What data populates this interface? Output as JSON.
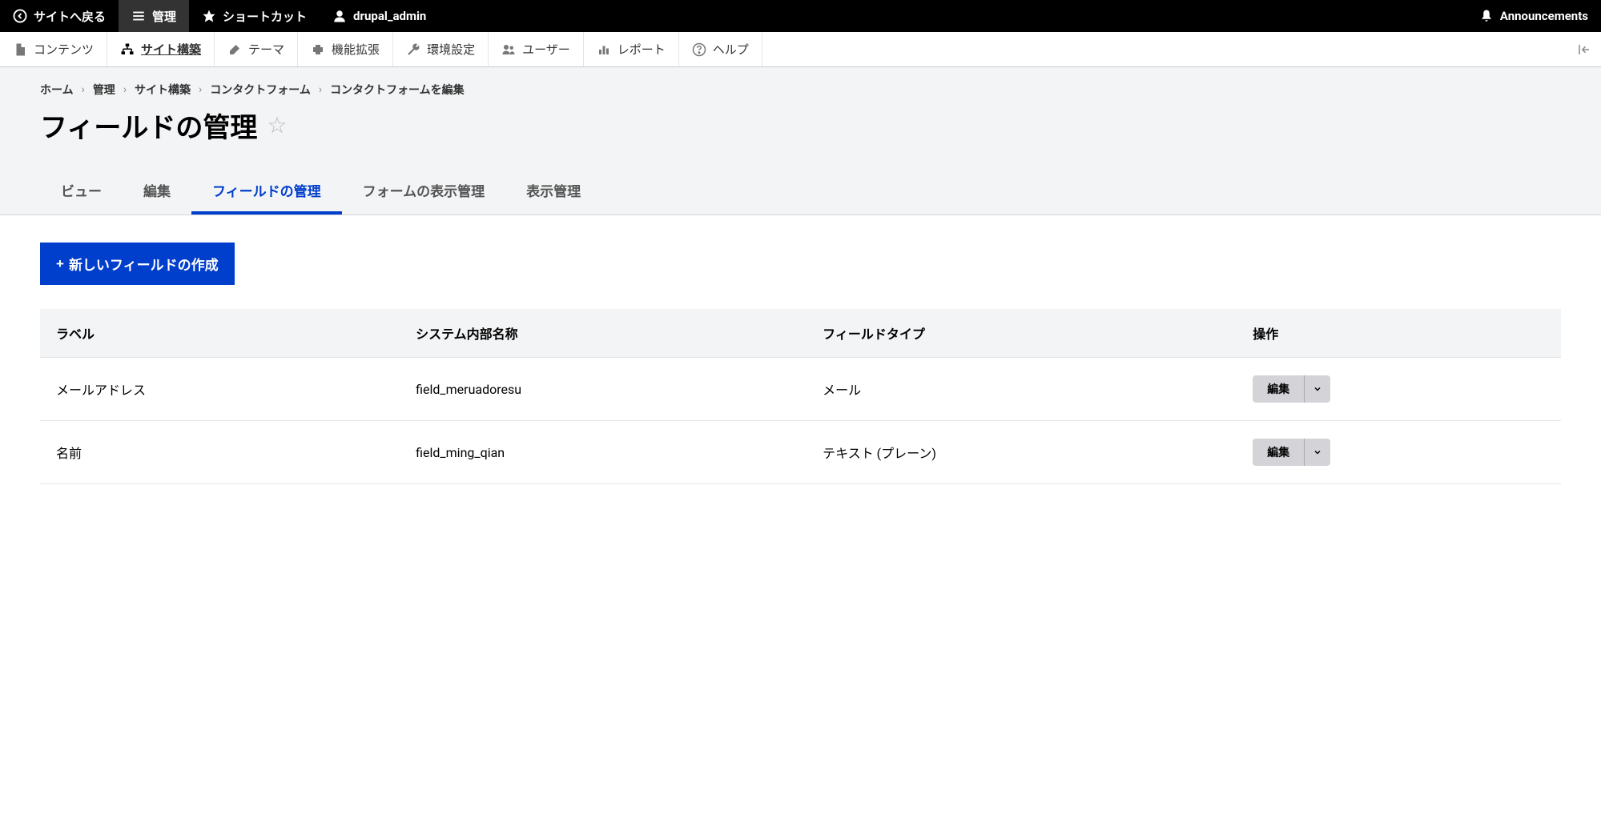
{
  "topbar": {
    "back_to_site": "サイトへ戻る",
    "manage": "管理",
    "shortcuts": "ショートカット",
    "user": "drupal_admin",
    "announcements": "Announcements"
  },
  "adminbar": {
    "content": "コンテンツ",
    "structure": "サイト構築",
    "appearance": "テーマ",
    "extend": "機能拡張",
    "configuration": "環境設定",
    "people": "ユーザー",
    "reports": "レポート",
    "help": "ヘルプ"
  },
  "breadcrumb": {
    "items": [
      "ホーム",
      "管理",
      "サイト構築",
      "コンタクトフォーム",
      "コンタクトフォームを編集"
    ]
  },
  "page_title": "フィールドの管理",
  "tabs": {
    "items": [
      {
        "label": "ビュー",
        "active": false
      },
      {
        "label": "編集",
        "active": false
      },
      {
        "label": "フィールドの管理",
        "active": true
      },
      {
        "label": "フォームの表示管理",
        "active": false
      },
      {
        "label": "表示管理",
        "active": false
      }
    ]
  },
  "button_create": "新しいフィールドの作成",
  "table": {
    "headers": {
      "label": "ラベル",
      "machine_name": "システム内部名称",
      "field_type": "フィールドタイプ",
      "operations": "操作"
    },
    "rows": [
      {
        "label": "メールアドレス",
        "machine_name": "field_meruadoresu",
        "field_type": "メール",
        "op": "編集"
      },
      {
        "label": "名前",
        "machine_name": "field_ming_qian",
        "field_type": "テキスト (プレーン)",
        "op": "編集"
      }
    ]
  }
}
